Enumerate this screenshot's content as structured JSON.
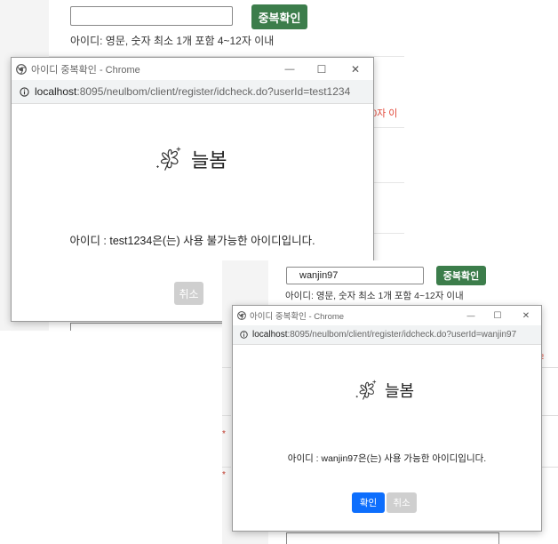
{
  "scene1": {
    "check_button": "중복확인",
    "id_hint": "아이디: 영문, 숫자 최소 1개 포함 4~12자 이내",
    "partial_error": "0자 이",
    "popup": {
      "title": "아이디 중복확인 - Chrome",
      "url_host": "localhost",
      "url_path": ":8095/neulbom/client/register/idcheck.do?userId=test1234",
      "brand": "늘봄",
      "message": "아이디 : test1234은(는) 사용 불가능한 아이디입니다.",
      "cancel_label": "취소"
    }
  },
  "scene2": {
    "id_value": "wanjin97",
    "check_button": "중복확인",
    "id_hint": "아이디: 영문, 숫자 최소 1개 포함 4~12자 이내",
    "popup": {
      "title": "아이디 중복확인 - Chrome",
      "url_host": "localhost",
      "url_path": ":8095/neulbom/client/register/idcheck.do?userId=wanjin97",
      "brand": "늘봄",
      "message": "아이디 : wanjin97은(는) 사용 가능한 아이디입니다.",
      "confirm_label": "확인",
      "cancel_label": "취소"
    }
  },
  "window_controls": {
    "minimize": "—",
    "maximize": "☐",
    "close": "✕"
  },
  "icons": {
    "chrome": "chrome-icon",
    "info": "info-icon",
    "clover": "clover-logo-icon"
  },
  "colors": {
    "green_button": "#3c7d4b",
    "confirm_blue": "#0d6efd",
    "cancel_gray": "#cfcfcf",
    "error_red": "#e24a3b"
  }
}
